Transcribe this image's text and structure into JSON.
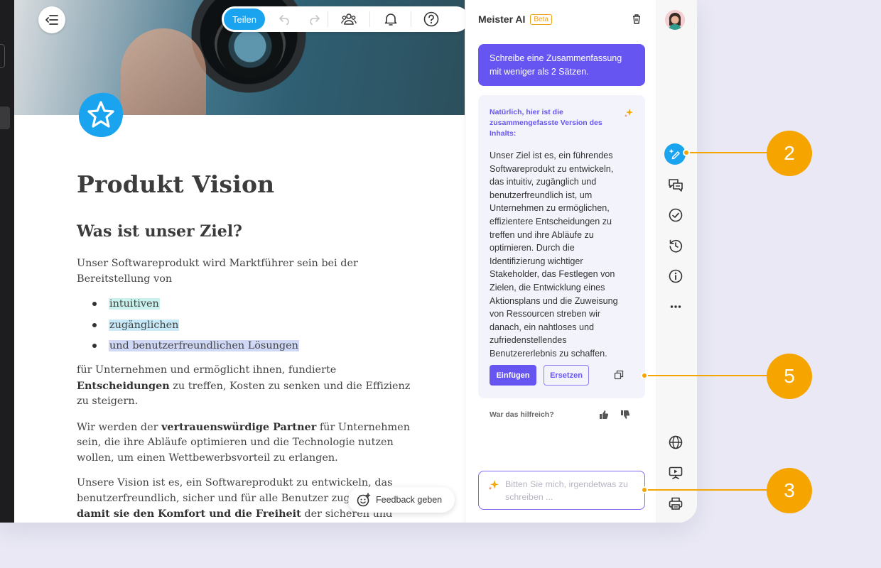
{
  "toolbar": {
    "share_label": "Teilen",
    "icons": [
      "undo-icon",
      "redo-icon",
      "users-icon",
      "bell-icon",
      "help-icon"
    ]
  },
  "document": {
    "title": "Produkt Vision",
    "heading": "Was ist unser Ziel?",
    "intro": "Unser Softwareprodukt wird Marktführer sein bei der Bereitstellung von",
    "bullets": [
      "intuitiven",
      "zugänglichen",
      "und benutzerfreundlichen Lösungen"
    ],
    "p1_a": "für Unternehmen und ermöglicht ihnen, fundierte ",
    "p1_b": "Entscheidungen",
    "p1_c": " zu treffen, Kosten zu senken und die Effizienz zu steigern.",
    "p2_a": "Wir werden der ",
    "p2_b": "vertrauenswürdige Partner",
    "p2_c": " für Unternehmen sein, die ihre Abläufe optimieren und die Technologie nutzen wollen, um einen Wettbewerbsvorteil zu erlangen.",
    "p3_a": "Unsere Vision ist es, ein Softwareprodukt zu entwickeln, das benutzerfreundlich, sicher und für alle Benutzer zugänglich ist, ",
    "p3_b": "damit sie den Komfort und die Freiheit",
    "p3_c": " der sicheren und zuverlässigen Nutzung von Technologie erleben können. Wir streben danach, ein Produkt zu"
  },
  "feedback": {
    "label": "Feedback geben"
  },
  "ai_panel": {
    "title": "Meister AI",
    "beta": "Beta",
    "prompt": "Schreibe eine Zusammenfassung mit weniger als 2 Sätzen.",
    "answer_heading": "Natürlich, hier ist die zusammengefasste Version des Inhalts:",
    "answer_text": "Unser Ziel ist es, ein führendes Softwareprodukt zu entwickeln, das intuitiv, zugänglich und benutzerfreundlich ist, um Unternehmen zu ermöglichen, effizientere Entscheidungen zu treffen und ihre Abläufe zu optimieren. Durch die Identifizierung wichtiger Stakeholder, das Festlegen von Zielen, die Entwicklung eines Aktionsplans und die Zuweisung von Ressourcen streben wir danach, ein nahtloses und zufriedenstellendes Benutzererlebnis zu schaffen.",
    "insert_label": "Einfügen",
    "replace_label": "Ersetzen",
    "helpful_label": "War das hilfreich?",
    "input_placeholder": "Bitten Sie mich, irgendetwas zu schreiben ..."
  },
  "rail": {
    "icons": [
      "avatar",
      "ai-pen-icon",
      "comments-icon",
      "check-circle-icon",
      "history-icon",
      "info-icon",
      "more-icon",
      "globe-icon",
      "presentation-icon",
      "print-icon"
    ]
  },
  "callouts": [
    "2",
    "5",
    "3"
  ],
  "colors": {
    "accent_blue": "#1aa3ef",
    "ai_purple": "#6755f2",
    "callout_orange": "#f6a500"
  }
}
